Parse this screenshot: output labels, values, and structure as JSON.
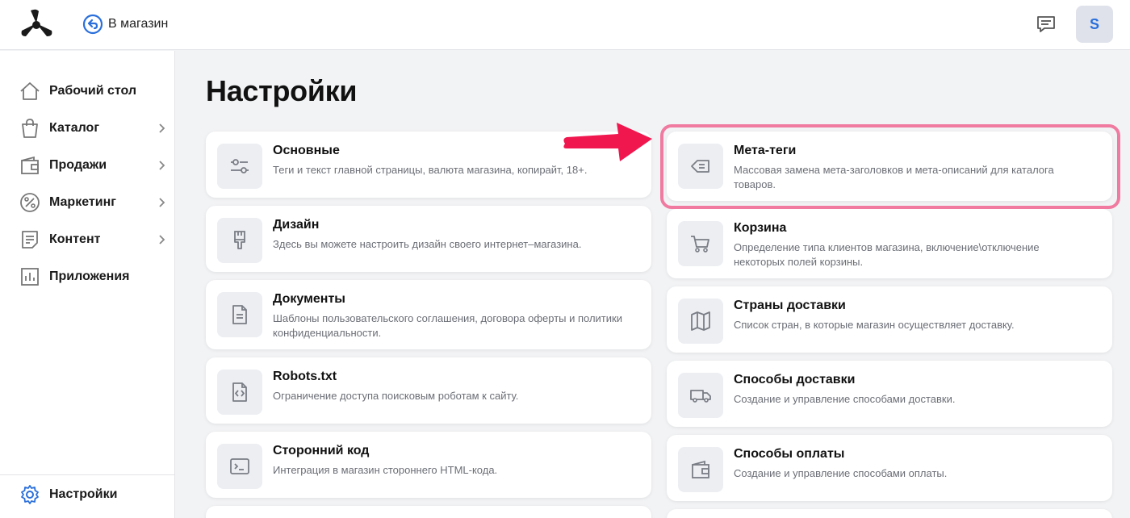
{
  "header": {
    "back_label": "В магазин",
    "avatar_letter": "S"
  },
  "sidebar": {
    "items": [
      {
        "label": "Рабочий стол",
        "icon": "home-icon"
      },
      {
        "label": "Каталог",
        "icon": "shopping-bag-icon"
      },
      {
        "label": "Продажи",
        "icon": "wallet-icon"
      },
      {
        "label": "Маркетинг",
        "icon": "percent-icon"
      },
      {
        "label": "Контент",
        "icon": "document-icon"
      },
      {
        "label": "Приложения",
        "icon": "bar-chart-icon"
      }
    ],
    "settings_label": "Настройки"
  },
  "page": {
    "title": "Настройки"
  },
  "cards_left": [
    {
      "title": "Основные",
      "desc": "Теги и текст главной страницы, валюта магазина, копирайт, 18+.",
      "icon": "sliders-icon"
    },
    {
      "title": "Дизайн",
      "desc": "Здесь вы можете настроить дизайн своего интернет–магазина.",
      "icon": "brush-icon"
    },
    {
      "title": "Документы",
      "desc": "Шаблоны пользовательского соглашения, договора оферты и политики конфиденциальности.",
      "icon": "file-text-icon"
    },
    {
      "title": "Robots.txt",
      "desc": "Ограничение доступа поисковым роботам к сайту.",
      "icon": "file-code-icon"
    },
    {
      "title": "Сторонний код",
      "desc": "Интеграция в магазин стороннего HTML-кода.",
      "icon": "terminal-icon"
    }
  ],
  "cards_right": [
    {
      "title": "Мета-теги",
      "desc": "Массовая замена мета-заголовков и мета-описаний для каталога товаров.",
      "icon": "tag-icon"
    },
    {
      "title": "Корзина",
      "desc": "Определение типа клиентов магазина, включение\\отключение некоторых полей корзины.",
      "icon": "cart-icon"
    },
    {
      "title": "Страны доставки",
      "desc": "Список стран, в которые магазин осуществляет доставку.",
      "icon": "map-icon"
    },
    {
      "title": "Способы доставки",
      "desc": "Создание и управление способами доставки.",
      "icon": "truck-icon"
    },
    {
      "title": "Способы оплаты",
      "desc": "Создание и управление способами оплаты.",
      "icon": "wallet-icon"
    }
  ],
  "colors": {
    "accent": "#2a6fdb",
    "highlight": "#f07aa0",
    "arrow": "#f0174f"
  }
}
